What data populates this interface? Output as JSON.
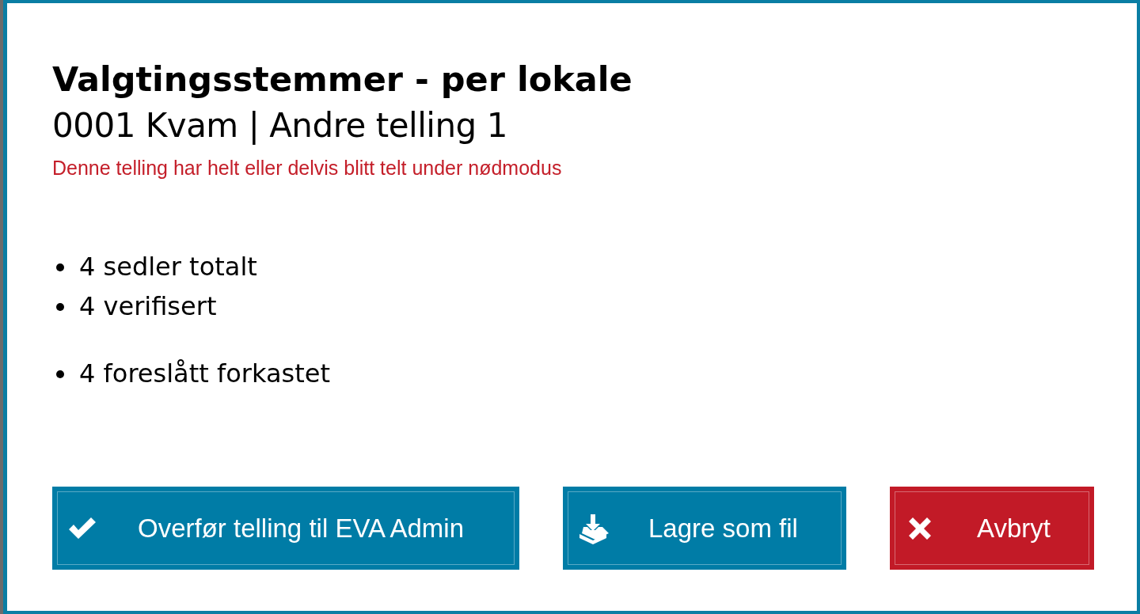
{
  "dialog": {
    "title": "Valgtingsstemmer - per lokale",
    "subtitle": "0001 Kvam | Andre telling 1",
    "warning": "Denne telling har helt eller delvis blitt telt under nødmodus",
    "stat_groups": [
      [
        "4 sedler totalt",
        "4 verifisert"
      ],
      [
        "4 foreslått forkastet"
      ]
    ],
    "buttons": [
      {
        "label": "Overfør telling til EVA Admin",
        "kind": "transfer"
      },
      {
        "label": "Lagre som fil",
        "kind": "save"
      },
      {
        "label": "Avbryt",
        "kind": "cancel"
      }
    ]
  }
}
